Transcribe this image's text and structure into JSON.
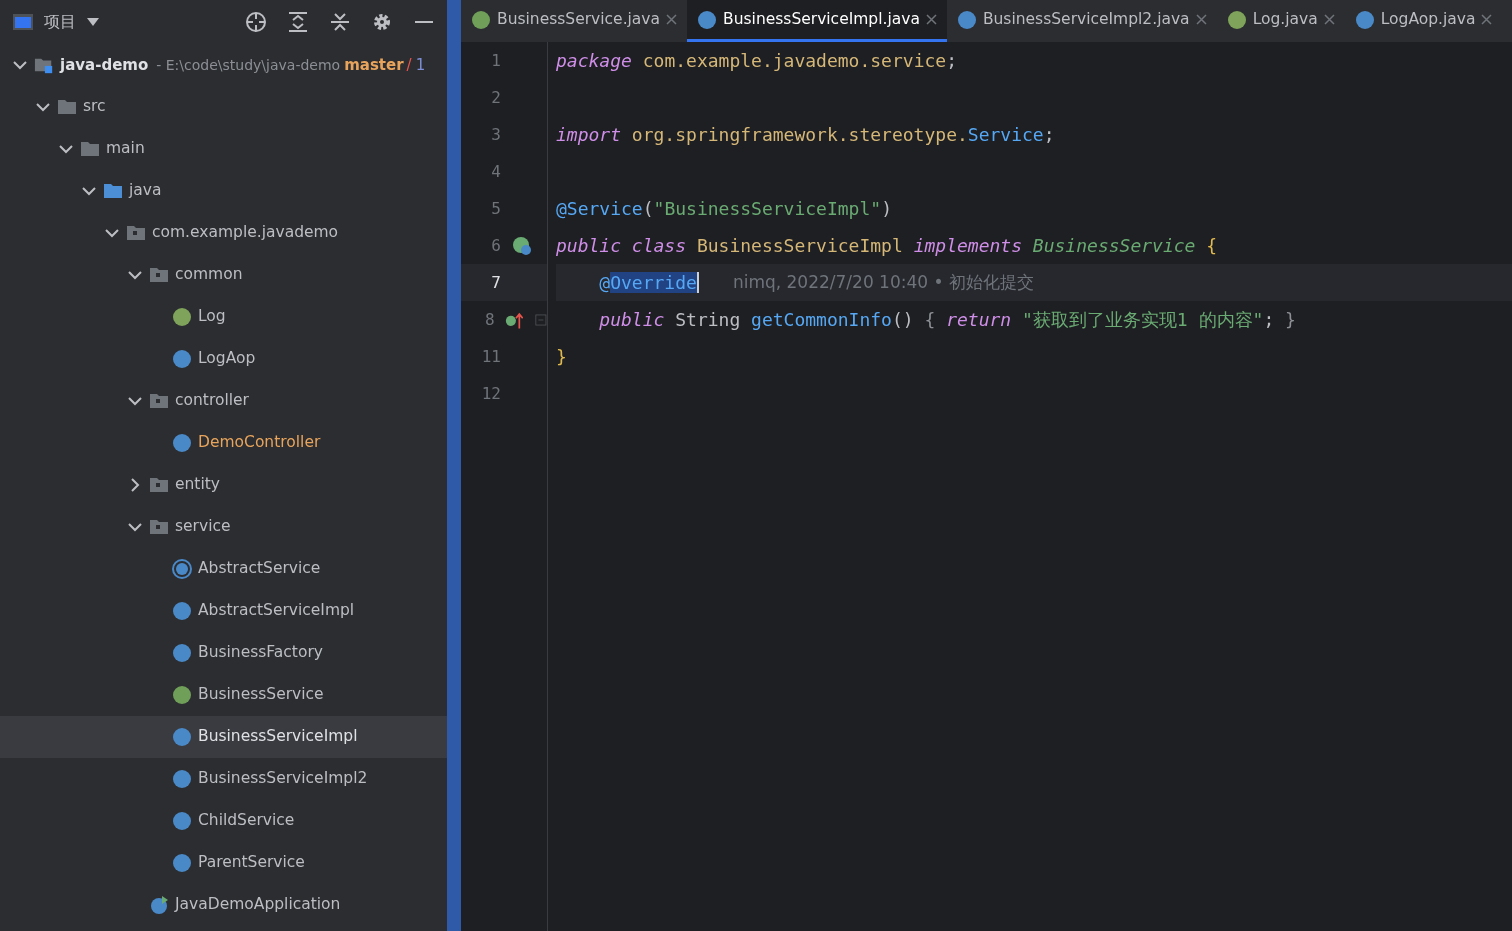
{
  "project_panel": {
    "title": "项目",
    "toolbar": [
      {
        "kind": "locate"
      },
      {
        "kind": "expand-all"
      },
      {
        "kind": "collapse-all"
      },
      {
        "kind": "settings"
      },
      {
        "kind": "hide"
      }
    ],
    "root": {
      "name": "java-demo",
      "path": "- E:\\code\\study\\java-demo",
      "branch": "master",
      "separator": "/",
      "count": "1",
      "expanded": true
    },
    "tree": [
      {
        "name": "src",
        "kind": "folder",
        "expanded": true,
        "selected": false,
        "modified": false,
        "children": [
          {
            "name": "main",
            "kind": "folder",
            "expanded": true,
            "selected": false,
            "modified": false,
            "children": [
              {
                "name": "java",
                "kind": "source-folder",
                "expanded": true,
                "selected": false,
                "modified": false,
                "children": [
                  {
                    "name": "com.example.javademo",
                    "kind": "package",
                    "expanded": true,
                    "selected": false,
                    "modified": false,
                    "children": [
                      {
                        "name": "common",
                        "kind": "package",
                        "expanded": true,
                        "selected": false,
                        "modified": false,
                        "children": [
                          {
                            "name": "Log",
                            "kind": "annotation",
                            "selected": false,
                            "modified": false
                          },
                          {
                            "name": "LogAop",
                            "kind": "class",
                            "selected": false,
                            "modified": false
                          }
                        ]
                      },
                      {
                        "name": "controller",
                        "kind": "package",
                        "expanded": true,
                        "selected": false,
                        "modified": false,
                        "children": [
                          {
                            "name": "DemoController",
                            "kind": "class",
                            "selected": false,
                            "modified": true
                          }
                        ]
                      },
                      {
                        "name": "entity",
                        "kind": "package",
                        "expanded": false,
                        "selected": false,
                        "modified": false
                      },
                      {
                        "name": "service",
                        "kind": "package",
                        "expanded": true,
                        "selected": false,
                        "modified": false,
                        "children": [
                          {
                            "name": "AbstractService",
                            "kind": "abstract",
                            "selected": false,
                            "modified": false
                          },
                          {
                            "name": "AbstractServiceImpl",
                            "kind": "class",
                            "selected": false,
                            "modified": false
                          },
                          {
                            "name": "BusinessFactory",
                            "kind": "class",
                            "selected": false,
                            "modified": false
                          },
                          {
                            "name": "BusinessService",
                            "kind": "interface",
                            "selected": false,
                            "modified": false
                          },
                          {
                            "name": "BusinessServiceImpl",
                            "kind": "class",
                            "selected": true,
                            "modified": false
                          },
                          {
                            "name": "BusinessServiceImpl2",
                            "kind": "class",
                            "selected": false,
                            "modified": false
                          },
                          {
                            "name": "ChildService",
                            "kind": "class",
                            "selected": false,
                            "modified": false
                          },
                          {
                            "name": "ParentService",
                            "kind": "class",
                            "selected": false,
                            "modified": false
                          }
                        ]
                      },
                      {
                        "name": "JavaDemoApplication",
                        "kind": "app",
                        "selected": false,
                        "modified": false
                      }
                    ]
                  }
                ]
              }
            ]
          }
        ]
      }
    ]
  },
  "tabs": [
    {
      "label": "BusinessService.java",
      "kind": "interface",
      "selected": false
    },
    {
      "label": "BusinessServiceImpl.java",
      "kind": "class",
      "selected": true
    },
    {
      "label": "BusinessServiceImpl2.java",
      "kind": "class",
      "selected": false
    },
    {
      "label": "Log.java",
      "kind": "annotation",
      "selected": false
    },
    {
      "label": "LogAop.java",
      "kind": "class",
      "selected": false
    }
  ],
  "editor": {
    "lines": [
      {
        "number": "1",
        "current": false,
        "tokens": [
          {
            "kind": "keyword",
            "text": "package "
          },
          {
            "kind": "package",
            "text": "com.example.javademo.service"
          },
          {
            "kind": "plain",
            "text": ";"
          }
        ]
      },
      {
        "number": "2",
        "current": false
      },
      {
        "number": "3",
        "current": false,
        "tokens": [
          {
            "kind": "keyword",
            "text": "import "
          },
          {
            "kind": "package",
            "text": "org.springframework.stereotype."
          },
          {
            "kind": "reference",
            "text": "Service"
          },
          {
            "kind": "plain",
            "text": ";"
          }
        ]
      },
      {
        "number": "4",
        "current": false
      },
      {
        "number": "5",
        "current": false,
        "tokens": [
          {
            "kind": "annotation",
            "text": "@Service"
          },
          {
            "kind": "plain",
            "text": "("
          },
          {
            "kind": "string",
            "text": "\"BusinessServiceImpl\""
          },
          {
            "kind": "plain",
            "text": ")"
          }
        ]
      },
      {
        "number": "6",
        "current": false,
        "gutter_icon": {
          "kind": "implements"
        },
        "tokens": [
          {
            "kind": "keyword",
            "text": "public class "
          },
          {
            "kind": "classname",
            "text": "BusinessServiceImpl "
          },
          {
            "kind": "keyword",
            "text": "implements "
          },
          {
            "kind": "interface",
            "text": "BusinessService "
          },
          {
            "kind": "brace",
            "text": "{"
          }
        ]
      },
      {
        "number": "7",
        "current": true,
        "tokens": [
          {
            "kind": "annotation",
            "text": "    @"
          },
          {
            "kind": "selected",
            "text": "Override"
          }
        ],
        "blame": "nimq, 2022/7/20 10:40 • 初始化提交"
      },
      {
        "number": "8",
        "current": false,
        "gutter_icon": {
          "kind": "override"
        },
        "fold": true,
        "tokens": [
          {
            "kind": "keyword",
            "text": "    public "
          },
          {
            "kind": "plain",
            "text": "String "
          },
          {
            "kind": "method",
            "text": "getCommonInfo"
          },
          {
            "kind": "plain",
            "text": "() "
          },
          {
            "kind": "folded",
            "text": "{ "
          },
          {
            "kind": "keyword",
            "text": "return "
          },
          {
            "kind": "string",
            "text": "\"获取到了业务实现1 的内容\""
          },
          {
            "kind": "plain",
            "text": "; "
          },
          {
            "kind": "folded",
            "text": "}"
          }
        ]
      },
      {
        "number": "11",
        "current": false,
        "tokens": [
          {
            "kind": "brace",
            "text": "}"
          }
        ]
      },
      {
        "number": "12",
        "current": false
      }
    ]
  }
}
